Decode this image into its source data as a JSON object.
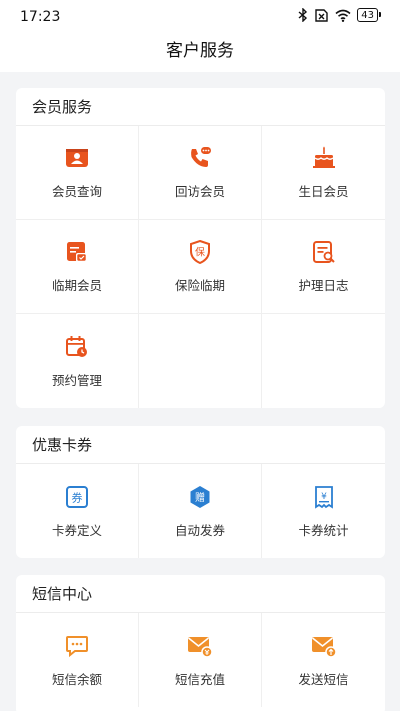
{
  "status_bar": {
    "time": "17:23",
    "battery": "43"
  },
  "header": {
    "title": "客户服务"
  },
  "sections": [
    {
      "title": "会员服务",
      "items": [
        "会员查询",
        "回访会员",
        "生日会员",
        "临期会员",
        "保险临期",
        "护理日志",
        "预约管理"
      ]
    },
    {
      "title": "优惠卡券",
      "items": [
        "卡券定义",
        "自动发券",
        "卡券统计"
      ]
    },
    {
      "title": "短信中心",
      "items": [
        "短信余额",
        "短信充值",
        "发送短信"
      ]
    }
  ],
  "icon_glyphs": {
    "insurance": "保",
    "gift": "赠",
    "coupon": "券",
    "yen": "¥"
  },
  "colors": {
    "member_icon": "#e8541e",
    "coupon_icon": "#2b7fd1",
    "sms_icon": "#f0902a"
  }
}
